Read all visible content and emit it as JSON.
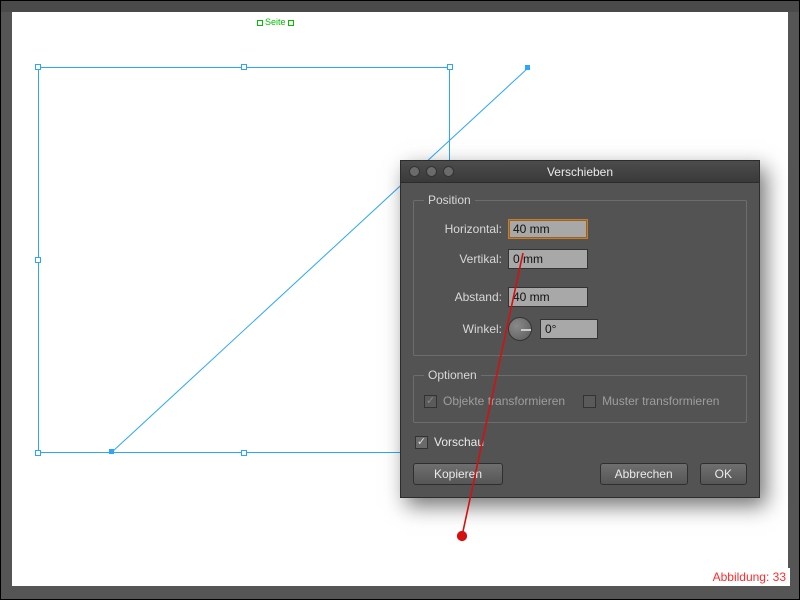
{
  "canvas": {
    "seite_label": "Seite"
  },
  "dialog": {
    "title": "Verschieben",
    "position": {
      "legend": "Position",
      "horizontal_label": "Horizontal:",
      "horizontal_value": "40 mm",
      "vertikal_label": "Vertikal:",
      "vertikal_value": "0 mm",
      "abstand_label": "Abstand:",
      "abstand_value": "40 mm",
      "winkel_label": "Winkel:",
      "winkel_value": "0°"
    },
    "optionen": {
      "legend": "Optionen",
      "objekte_label": "Objekte transformieren",
      "objekte_checked": true,
      "muster_label": "Muster transformieren",
      "muster_checked": false
    },
    "vorschau_label": "Vorschau",
    "vorschau_checked": true,
    "buttons": {
      "kopieren": "Kopieren",
      "abbrechen": "Abbrechen",
      "ok": "OK"
    }
  },
  "caption": "Abbildung: 33"
}
